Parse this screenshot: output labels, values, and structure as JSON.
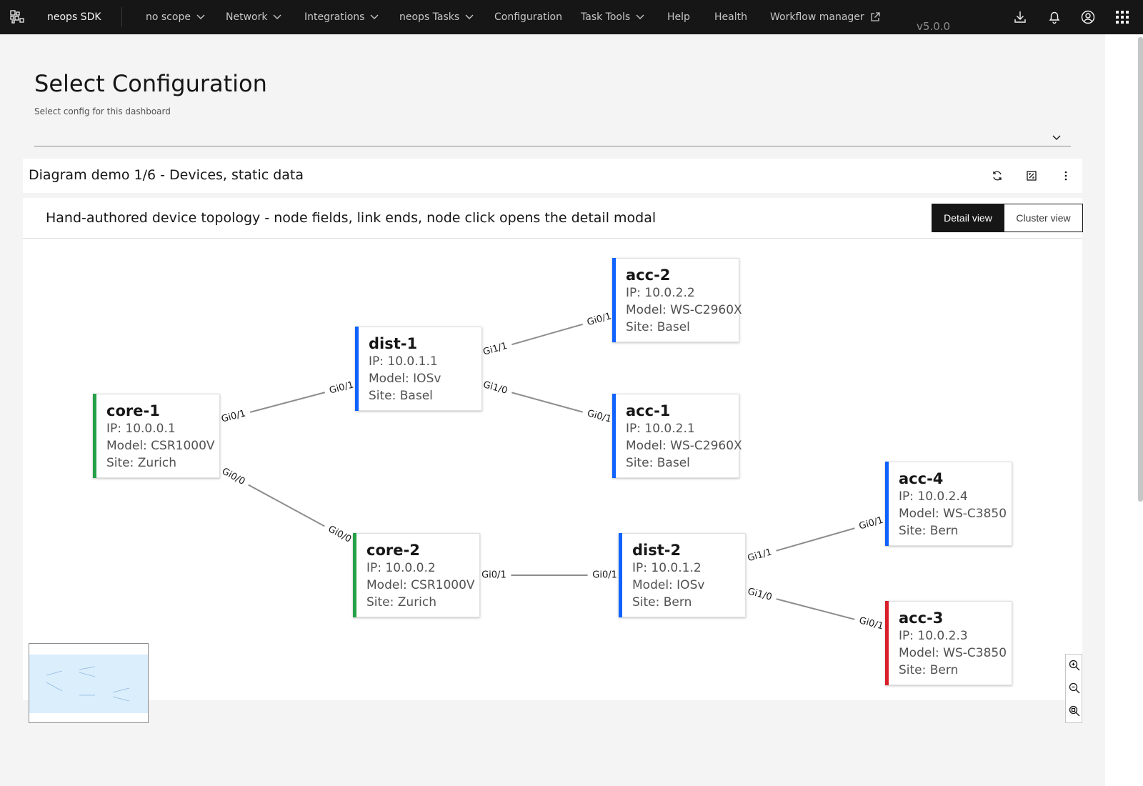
{
  "header": {
    "brand": "neops SDK",
    "version": "v5.0.0",
    "nav": [
      {
        "label": "no scope",
        "dropdown": true
      },
      {
        "label": "Network",
        "dropdown": true
      },
      {
        "label": "Integrations",
        "dropdown": true
      },
      {
        "label": "neops Tasks",
        "dropdown": true
      },
      {
        "label": "Configuration",
        "dropdown": false
      },
      {
        "label": "Task Tools",
        "dropdown": true
      },
      {
        "label": "Help",
        "dropdown": false
      },
      {
        "label": "Health",
        "dropdown": false
      },
      {
        "label": "Workflow manager",
        "external": true
      }
    ],
    "icons": [
      "download-icon",
      "notification-icon",
      "user-avatar-icon",
      "app-switcher-icon"
    ]
  },
  "config": {
    "title": "Select Configuration",
    "subtitle": "Select config for this dashboard",
    "selected_value": ""
  },
  "card": {
    "title": "Diagram demo 1/6 - Devices, static data",
    "tools": [
      "refresh-icon",
      "maximize-icon",
      "overflow-menu-icon"
    ]
  },
  "panel": {
    "description": "Hand-authored device topology - node fields, link ends, node click opens the detail modal",
    "views": {
      "detail": "Detail view",
      "cluster": "Cluster view"
    }
  },
  "colors": {
    "core": "#24a148",
    "distribution": "#0f62fe",
    "access": "#0f62fe",
    "alert": "#da1e28",
    "link": "#8d8d8d"
  },
  "nodes": [
    {
      "id": "core-1",
      "name": "core-1",
      "ip": "IP: 10.0.0.1",
      "model": "Model: CSR1000V",
      "site": "Site: Zurich",
      "color": "#24a148"
    },
    {
      "id": "dist-1",
      "name": "dist-1",
      "ip": "IP: 10.0.1.1",
      "model": "Model: IOSv",
      "site": "Site: Basel",
      "color": "#0f62fe"
    },
    {
      "id": "acc-2",
      "name": "acc-2",
      "ip": "IP: 10.0.2.2",
      "model": "Model: WS-C2960X",
      "site": "Site: Basel",
      "color": "#0f62fe"
    },
    {
      "id": "acc-1",
      "name": "acc-1",
      "ip": "IP: 10.0.2.1",
      "model": "Model: WS-C2960X",
      "site": "Site: Basel",
      "color": "#0f62fe"
    },
    {
      "id": "core-2",
      "name": "core-2",
      "ip": "IP: 10.0.0.2",
      "model": "Model: CSR1000V",
      "site": "Site: Zurich",
      "color": "#24a148"
    },
    {
      "id": "dist-2",
      "name": "dist-2",
      "ip": "IP: 10.0.1.2",
      "model": "Model: IOSv",
      "site": "Site: Bern",
      "color": "#0f62fe"
    },
    {
      "id": "acc-4",
      "name": "acc-4",
      "ip": "IP: 10.0.2.4",
      "model": "Model: WS-C3850",
      "site": "Site: Bern",
      "color": "#0f62fe"
    },
    {
      "id": "acc-3",
      "name": "acc-3",
      "ip": "IP: 10.0.2.3",
      "model": "Model: WS-C3850",
      "site": "Site: Bern",
      "color": "#da1e28"
    }
  ],
  "links": [
    {
      "from": "core-1",
      "to": "dist-1",
      "from_port": "Gi0/1",
      "to_port": "Gi0/1"
    },
    {
      "from": "core-1",
      "to": "core-2",
      "from_port": "Gi0/0",
      "to_port": "Gi0/0"
    },
    {
      "from": "dist-1",
      "to": "acc-2",
      "from_port": "Gi1/1",
      "to_port": "Gi0/1"
    },
    {
      "from": "dist-1",
      "to": "acc-1",
      "from_port": "Gi1/0",
      "to_port": "Gi0/1"
    },
    {
      "from": "core-2",
      "to": "dist-2",
      "from_port": "Gi0/1",
      "to_port": "Gi0/1"
    },
    {
      "from": "dist-2",
      "to": "acc-4",
      "from_port": "Gi1/1",
      "to_port": "Gi0/1"
    },
    {
      "from": "dist-2",
      "to": "acc-3",
      "from_port": "Gi1/0",
      "to_port": "Gi0/1"
    }
  ]
}
